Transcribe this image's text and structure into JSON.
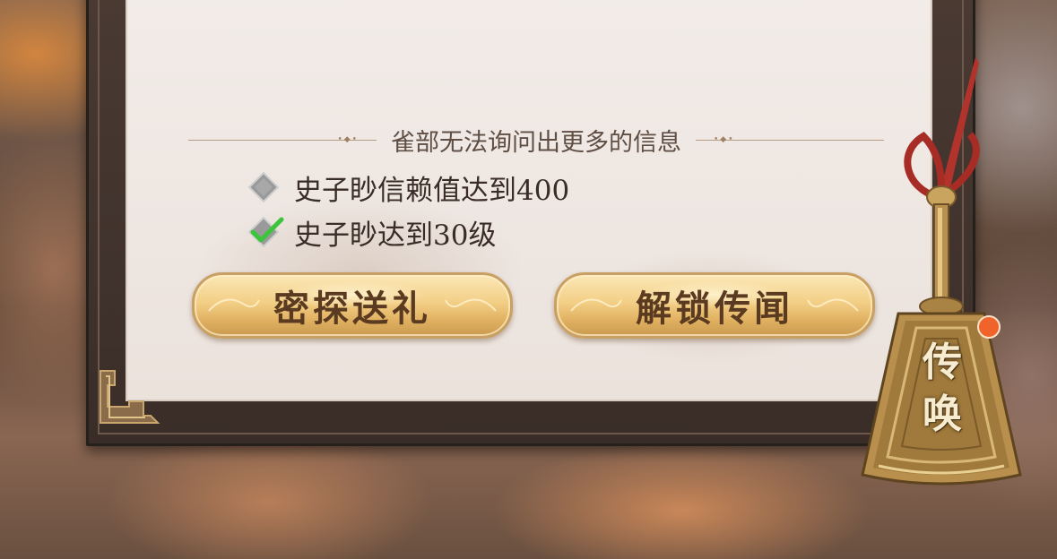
{
  "section_title": "雀部无法询问出更多的信息",
  "requirements": [
    {
      "text": "史子眇信赖值达到400",
      "status": "unmet",
      "icon": "gray-diamond-icon"
    },
    {
      "text": "史子眇达到30级",
      "status": "met",
      "icon": "green-check-icon"
    }
  ],
  "buttons": {
    "gift": "密探送礼",
    "unlock": "解锁传闻"
  },
  "summon": {
    "line1": "传",
    "line2": "唤",
    "has_notification": true
  },
  "colors": {
    "panel": "#efe8e3",
    "frame": "#433530",
    "button_gold": "#f3cf86",
    "button_text": "#5a3a20",
    "check_green": "#3cc43c",
    "notify_dot": "#f0632a"
  }
}
